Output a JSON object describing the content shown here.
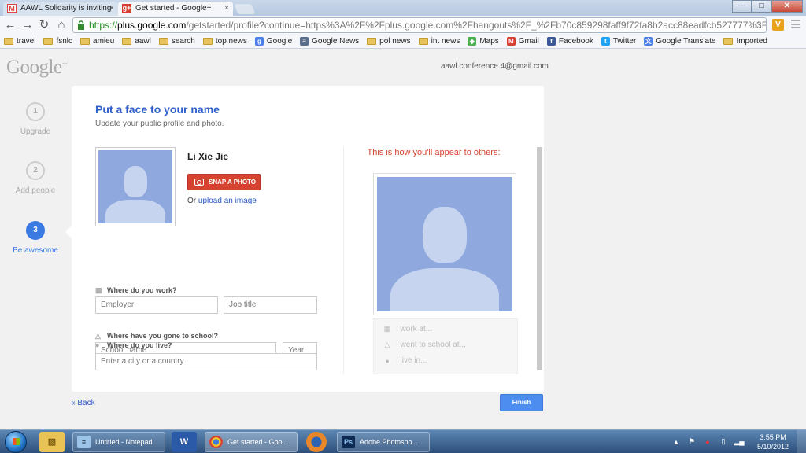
{
  "browser": {
    "tabs": [
      {
        "title": "AAWL Solidarity is inviting",
        "close": "×"
      },
      {
        "title": "Get started - Google+",
        "close": "×"
      }
    ],
    "window_buttons": {
      "minimize": "—",
      "maximize": "□",
      "close": "✕"
    },
    "url": {
      "scheme": "https://",
      "host": "plus.google.com",
      "path": "/getstarted/profile?continue=https%3A%2F%2Fplus.google.com%2Fhangouts%2F_%2Fb70c859298faff9f72fa8b2acc88eadfcb527777%3Fhcb%3D1"
    },
    "bookmarks": [
      {
        "label": "travel",
        "icon": "folder-icon"
      },
      {
        "label": "fsnlc",
        "icon": "folder-icon"
      },
      {
        "label": "amieu",
        "icon": "folder-icon"
      },
      {
        "label": "aawl",
        "icon": "folder-icon"
      },
      {
        "label": "search",
        "icon": "folder-icon"
      },
      {
        "label": "top news",
        "icon": "folder-icon"
      },
      {
        "label": "Google",
        "icon": "google-icon"
      },
      {
        "label": "Google News",
        "icon": "news-icon"
      },
      {
        "label": "pol news",
        "icon": "folder-icon"
      },
      {
        "label": "int news",
        "icon": "folder-icon"
      },
      {
        "label": "Maps",
        "icon": "maps-icon"
      },
      {
        "label": "Gmail",
        "icon": "gmail-icon"
      },
      {
        "label": "Facebook",
        "icon": "facebook-icon"
      },
      {
        "label": "Twitter",
        "icon": "twitter-icon"
      },
      {
        "label": "Google Translate",
        "icon": "translate-icon"
      },
      {
        "label": "Imported",
        "icon": "folder-icon"
      }
    ]
  },
  "page": {
    "logo": "Google",
    "logo_plus": "+",
    "user_email": "aawl.conference.4@gmail.com",
    "steps": [
      {
        "number": "1",
        "label": "Upgrade"
      },
      {
        "number": "2",
        "label": "Add people"
      },
      {
        "number": "3",
        "label": "Be awesome"
      }
    ],
    "card": {
      "title": "Put a face to your name",
      "subtitle": "Update your public profile and photo.",
      "name": "Li Xie Jie",
      "snap_photo": "SNAP A PHOTO",
      "upload_prefix": "Or ",
      "upload_link": "upload an image",
      "work_label": "Where do you work?",
      "employer_placeholder": "Employer",
      "job_placeholder": "Job title",
      "school_label": "Where have you gone to school?",
      "school_placeholder": "School name",
      "year_placeholder": "Year",
      "live_label": "Where do you live?",
      "city_placeholder": "Enter a city or a country",
      "preview_title": "This is how you'll appear to others:",
      "preview_work": "I work at...",
      "preview_school": "I went to school at...",
      "preview_live": "I live in..."
    },
    "back": "« Back",
    "finish": "Finish"
  },
  "taskbar": {
    "tasks": [
      {
        "label": "Untitled - Notepad",
        "icon": "notepad-icon"
      },
      {
        "label": "Get started - Goo...",
        "icon": "chrome-icon"
      },
      {
        "label": "Adobe Photosho...",
        "icon": "photoshop-icon"
      }
    ],
    "pinned": [
      {
        "icon": "explorer-icon"
      },
      {
        "icon": "word-icon",
        "glyph": "W"
      },
      {
        "icon": "firefox-icon"
      }
    ],
    "time": "3:55 PM",
    "date": "5/10/2012"
  }
}
